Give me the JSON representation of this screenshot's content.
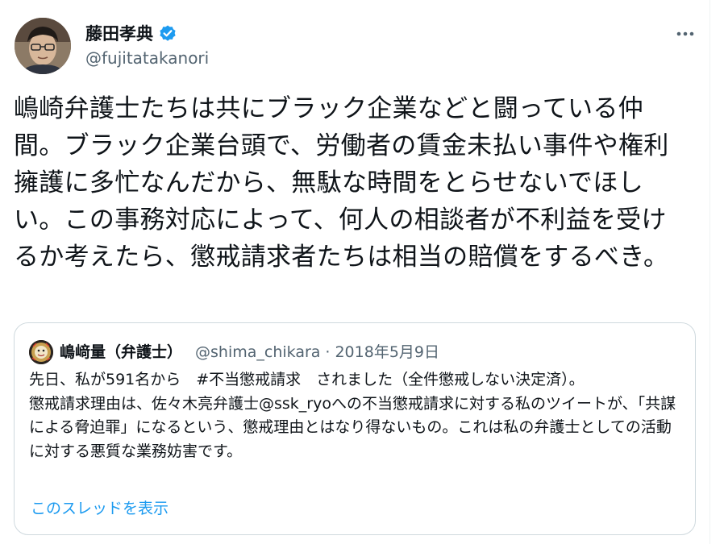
{
  "tweet": {
    "author": {
      "name": "藤田孝典",
      "handle": "@fujitatakanori",
      "verified": true
    },
    "more_icon": "ellipsis-icon",
    "text": "嶋崎弁護士たちは共にブラック企業などと闘っている仲間。ブラック企業台頭で、労働者の賃金未払い事件や権利擁護に多忙なんだから、無駄な時間をとらせないでほしい。この事務対応によって、何人の相談者が不利益を受けるか考えたら、懲戒請求者たちは相当の賠償をするべき。"
  },
  "quote": {
    "author": {
      "name": "嶋﨑量（弁護士）",
      "handle": "@shima_chikara",
      "separator": "·",
      "date": "2018年5月9日"
    },
    "text": "先日、私が591名から　#不当懲戒請求　されました（全件懲戒しない決定済）。\n懲戒請求理由は、佐々木亮弁護士@ssk_ryoへの不当懲戒請求に対する私のツイートが、「共謀による脅迫罪」になるという、懲戒理由とはなり得ないもの。これは私の弁護士としての活動に対する悪質な業務妨害です。",
    "show_thread_label": "このスレッドを表示"
  },
  "colors": {
    "text_primary": "#0f1419",
    "text_secondary": "#536471",
    "accent_blue": "#1d9bf0",
    "border": "#cfd9de"
  }
}
